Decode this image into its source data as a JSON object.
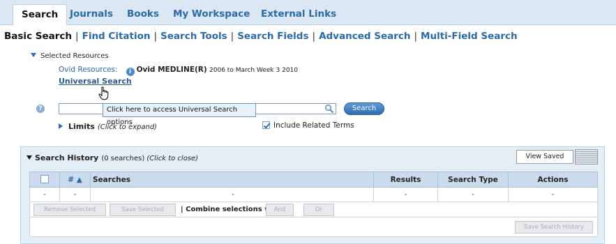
{
  "topnav": {
    "tabs": [
      {
        "label": "Search"
      },
      {
        "label": "Journals"
      },
      {
        "label": "Books"
      },
      {
        "label": "My Workspace"
      },
      {
        "label": "External Links"
      }
    ],
    "active_tab": "Search"
  },
  "subnav": {
    "items": [
      {
        "label": "Basic Search"
      },
      {
        "label": "Find Citation"
      },
      {
        "label": "Search Tools"
      },
      {
        "label": "Search Fields"
      },
      {
        "label": "Advanced Search"
      },
      {
        "label": "Multi-Field Search"
      }
    ],
    "separator": "|"
  },
  "resources": {
    "heading": "Selected Resources",
    "ovid_label": "Ovid Resources:",
    "database": "Ovid MEDLINE(R)",
    "range": "2006 to March Week 3 2010",
    "universal_link": "Universal Search"
  },
  "search": {
    "input_value": "",
    "button_label": "Search",
    "tooltip": "Click here to access Universal Search options",
    "limits_label": "Limits",
    "limits_hint": "(Click to expand)",
    "include_related_label": "Include Related Terms",
    "include_related_checked": true
  },
  "history": {
    "title": "Search History",
    "count_text": "(0 searches)",
    "close_hint": "(Click to close)",
    "view_saved_label": "View Saved",
    "columns": {
      "num": "# ▲",
      "searches": "Searches",
      "results": "Results",
      "search_type": "Search Type",
      "actions": "Actions"
    },
    "rows": [
      {
        "cb": "-",
        "num": "-",
        "search": "-",
        "results": "-",
        "search_type": "-",
        "actions": "-"
      }
    ],
    "remove_selected": "Remove Selected",
    "save_selected": "Save Selected",
    "combine_label": "| Combine selections with:",
    "and_label": "And",
    "or_label": "Or",
    "save_history": "Save Search History"
  },
  "colors": {
    "accent": "#2a6aa8",
    "nav_bg": "#dbe8f4",
    "panel_bg": "#e4eef7",
    "header_bg": "#c9dbec"
  }
}
